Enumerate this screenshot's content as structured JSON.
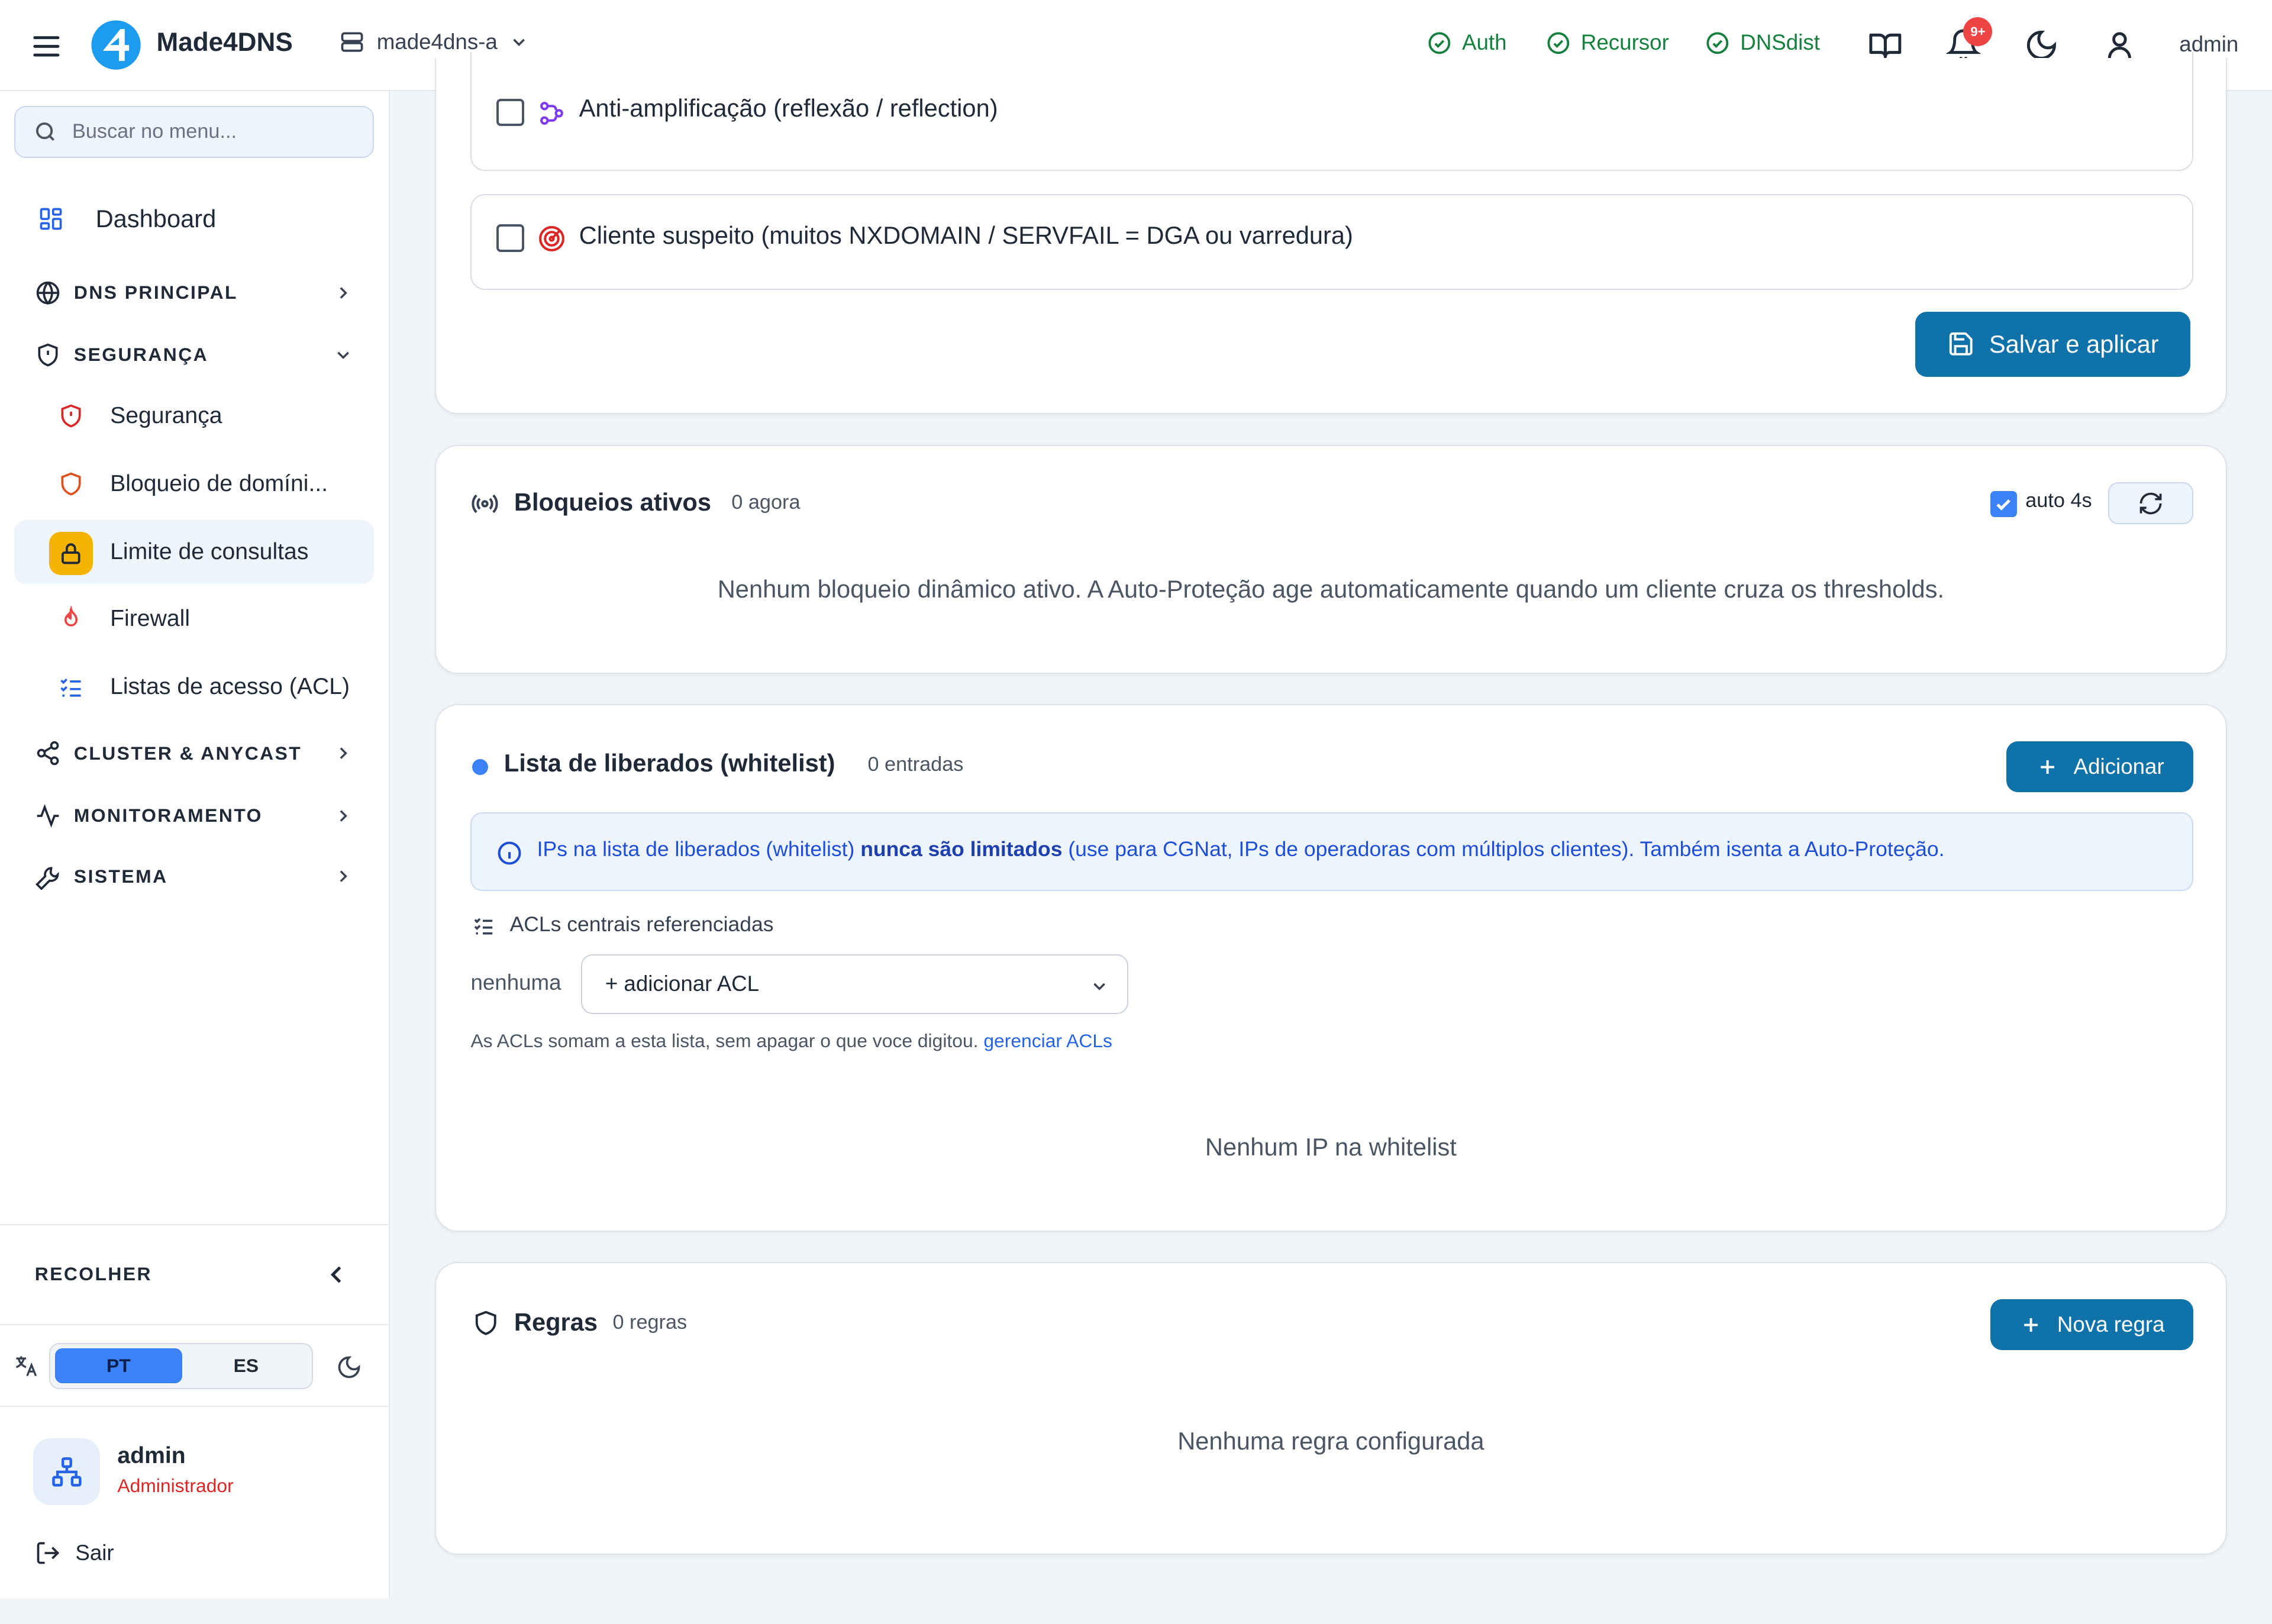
{
  "topbar": {
    "brand": "Made4DNS",
    "server": "made4dns-a",
    "statuses": [
      "Auth",
      "Recursor",
      "DNSdist"
    ],
    "notifications_badge": "9+",
    "user": "admin"
  },
  "sidebar": {
    "search_placeholder": "Buscar no menu...",
    "dashboard": "Dashboard",
    "sections": {
      "dns": "DNS PRINCIPAL",
      "security": "SEGURANÇA",
      "cluster": "CLUSTER & ANYCAST",
      "monitoring": "MONITORAMENTO",
      "system": "SISTEMA"
    },
    "security_items": [
      "Segurança",
      "Bloqueio de domíni...",
      "Limite de consultas",
      "Firewall",
      "Listas de acesso (ACL)"
    ],
    "collapse": "RECOLHER",
    "lang_pt": "PT",
    "lang_es": "ES",
    "profile_name": "admin",
    "profile_role": "Administrador",
    "logout": "Sair"
  },
  "protection": {
    "opt_amplification": "Anti-amplificação (reflexão / reflection)",
    "opt_suspect": "Cliente suspeito (muitos NXDOMAIN / SERVFAIL = DGA ou varredura)",
    "save": "Salvar e aplicar"
  },
  "blocks": {
    "title": "Bloqueios ativos",
    "meta": "0 agora",
    "auto": "auto 4s",
    "empty": "Nenhum bloqueio dinâmico ativo. A Auto-Proteção age automaticamente quando um cliente cruza os thresholds."
  },
  "whitelist": {
    "title": "Lista de liberados (whitelist)",
    "meta": "0 entradas",
    "add": "Adicionar",
    "info_prefix": "IPs na lista de liberados (whitelist) ",
    "info_bold": "nunca são limitados",
    "info_suffix": " (use para CGNat, IPs de operadoras com múltiplos clientes). Também isenta a Auto-Proteção.",
    "acl_heading": "ACLs centrais referenciadas",
    "acl_none": "nenhuma",
    "acl_select": "+ adicionar ACL",
    "acl_note": "As ACLs somam a esta lista, sem apagar o que voce digitou.",
    "acl_link": "gerenciar ACLs",
    "empty": "Nenhum IP na whitelist"
  },
  "rules": {
    "title": "Regras",
    "meta": "0 regras",
    "new": "Nova regra",
    "empty": "Nenhuma regra configurada"
  },
  "colors": {
    "primary": "#0f72a8",
    "status_green": "#15803d",
    "active_icon": "#f5b400"
  }
}
